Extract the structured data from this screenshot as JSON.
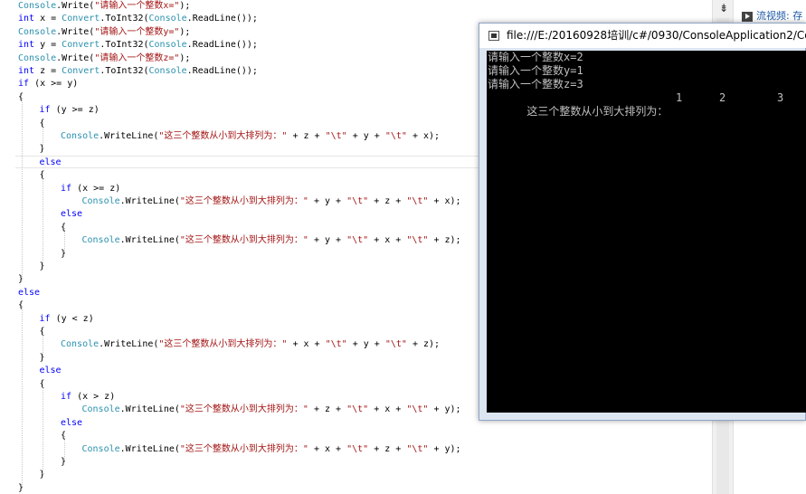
{
  "editor": {
    "lines": [
      {
        "indent": 0,
        "tokens": [
          {
            "t": "cls",
            "v": "Console"
          },
          {
            "t": "plain",
            "v": ".Write("
          },
          {
            "t": "str",
            "v": "\"请输入一个整数x=\""
          },
          {
            "t": "plain",
            "v": ");"
          }
        ]
      },
      {
        "indent": 0,
        "tokens": [
          {
            "t": "kw",
            "v": "int"
          },
          {
            "t": "plain",
            "v": " x = "
          },
          {
            "t": "cls",
            "v": "Convert"
          },
          {
            "t": "plain",
            "v": ".ToInt32("
          },
          {
            "t": "cls",
            "v": "Console"
          },
          {
            "t": "plain",
            "v": ".ReadLine());"
          }
        ]
      },
      {
        "indent": 0,
        "tokens": [
          {
            "t": "cls",
            "v": "Console"
          },
          {
            "t": "plain",
            "v": ".Write("
          },
          {
            "t": "str",
            "v": "\"请输入一个整数y=\""
          },
          {
            "t": "plain",
            "v": ");"
          }
        ]
      },
      {
        "indent": 0,
        "tokens": [
          {
            "t": "kw",
            "v": "int"
          },
          {
            "t": "plain",
            "v": " y = "
          },
          {
            "t": "cls",
            "v": "Convert"
          },
          {
            "t": "plain",
            "v": ".ToInt32("
          },
          {
            "t": "cls",
            "v": "Console"
          },
          {
            "t": "plain",
            "v": ".ReadLine());"
          }
        ]
      },
      {
        "indent": 0,
        "tokens": [
          {
            "t": "cls",
            "v": "Console"
          },
          {
            "t": "plain",
            "v": ".Write("
          },
          {
            "t": "str",
            "v": "\"请输入一个整数z=\""
          },
          {
            "t": "plain",
            "v": ");"
          }
        ]
      },
      {
        "indent": 0,
        "tokens": [
          {
            "t": "kw",
            "v": "int"
          },
          {
            "t": "plain",
            "v": " z = "
          },
          {
            "t": "cls",
            "v": "Convert"
          },
          {
            "t": "plain",
            "v": ".ToInt32("
          },
          {
            "t": "cls",
            "v": "Console"
          },
          {
            "t": "plain",
            "v": ".ReadLine());"
          }
        ]
      },
      {
        "indent": 0,
        "tokens": [
          {
            "t": "kw",
            "v": "if"
          },
          {
            "t": "plain",
            "v": " (x >= y)"
          }
        ]
      },
      {
        "indent": 0,
        "tokens": [
          {
            "t": "plain",
            "v": "{"
          }
        ]
      },
      {
        "indent": 1,
        "tokens": [
          {
            "t": "kw",
            "v": "if"
          },
          {
            "t": "plain",
            "v": " (y >= z)"
          }
        ]
      },
      {
        "indent": 1,
        "tokens": [
          {
            "t": "plain",
            "v": "{"
          }
        ]
      },
      {
        "indent": 2,
        "tokens": [
          {
            "t": "cls",
            "v": "Console"
          },
          {
            "t": "plain",
            "v": ".WriteLine("
          },
          {
            "t": "str",
            "v": "\"这三个整数从小到大排列为：\""
          },
          {
            "t": "plain",
            "v": " + z + "
          },
          {
            "t": "str",
            "v": "\"\\t\""
          },
          {
            "t": "plain",
            "v": " + y + "
          },
          {
            "t": "str",
            "v": "\"\\t\""
          },
          {
            "t": "plain",
            "v": " + x);"
          }
        ]
      },
      {
        "indent": 1,
        "tokens": [
          {
            "t": "plain",
            "v": "}"
          }
        ]
      },
      {
        "indent": 1,
        "tokens": [
          {
            "t": "kw",
            "v": "else"
          }
        ]
      },
      {
        "indent": 1,
        "tokens": [
          {
            "t": "plain",
            "v": "{"
          }
        ]
      },
      {
        "indent": 2,
        "tokens": [
          {
            "t": "kw",
            "v": "if"
          },
          {
            "t": "plain",
            "v": " (x >= z)"
          }
        ]
      },
      {
        "indent": 3,
        "tokens": [
          {
            "t": "cls",
            "v": "Console"
          },
          {
            "t": "plain",
            "v": ".WriteLine("
          },
          {
            "t": "str",
            "v": "\"这三个整数从小到大排列为：\""
          },
          {
            "t": "plain",
            "v": " + y + "
          },
          {
            "t": "str",
            "v": "\"\\t\""
          },
          {
            "t": "plain",
            "v": " + z + "
          },
          {
            "t": "str",
            "v": "\"\\t\""
          },
          {
            "t": "plain",
            "v": " + x);"
          }
        ]
      },
      {
        "indent": 2,
        "tokens": [
          {
            "t": "kw",
            "v": "else"
          }
        ]
      },
      {
        "indent": 2,
        "tokens": [
          {
            "t": "plain",
            "v": "{"
          }
        ]
      },
      {
        "indent": 3,
        "tokens": [
          {
            "t": "cls",
            "v": "Console"
          },
          {
            "t": "plain",
            "v": ".WriteLine("
          },
          {
            "t": "str",
            "v": "\"这三个整数从小到大排列为：\""
          },
          {
            "t": "plain",
            "v": " + y + "
          },
          {
            "t": "str",
            "v": "\"\\t\""
          },
          {
            "t": "plain",
            "v": " + x + "
          },
          {
            "t": "str",
            "v": "\"\\t\""
          },
          {
            "t": "plain",
            "v": " + z);"
          }
        ]
      },
      {
        "indent": 2,
        "tokens": [
          {
            "t": "plain",
            "v": "}"
          }
        ]
      },
      {
        "indent": 1,
        "tokens": [
          {
            "t": "plain",
            "v": "}"
          }
        ]
      },
      {
        "indent": 0,
        "tokens": [
          {
            "t": "plain",
            "v": "}"
          }
        ]
      },
      {
        "indent": 0,
        "tokens": [
          {
            "t": "kw",
            "v": "else"
          }
        ]
      },
      {
        "indent": 0,
        "tokens": [
          {
            "t": "plain",
            "v": "{"
          }
        ]
      },
      {
        "indent": 1,
        "tokens": [
          {
            "t": "kw",
            "v": "if"
          },
          {
            "t": "plain",
            "v": " (y < z)"
          }
        ]
      },
      {
        "indent": 1,
        "tokens": [
          {
            "t": "plain",
            "v": "{"
          }
        ]
      },
      {
        "indent": 2,
        "tokens": [
          {
            "t": "cls",
            "v": "Console"
          },
          {
            "t": "plain",
            "v": ".WriteLine("
          },
          {
            "t": "str",
            "v": "\"这三个整数从小到大排列为：\""
          },
          {
            "t": "plain",
            "v": " + x + "
          },
          {
            "t": "str",
            "v": "\"\\t\""
          },
          {
            "t": "plain",
            "v": " + y + "
          },
          {
            "t": "str",
            "v": "\"\\t\""
          },
          {
            "t": "plain",
            "v": " + z);"
          }
        ]
      },
      {
        "indent": 1,
        "tokens": [
          {
            "t": "plain",
            "v": "}"
          }
        ]
      },
      {
        "indent": 1,
        "tokens": [
          {
            "t": "kw",
            "v": "else"
          }
        ]
      },
      {
        "indent": 1,
        "tokens": [
          {
            "t": "plain",
            "v": "{"
          }
        ]
      },
      {
        "indent": 2,
        "tokens": [
          {
            "t": "kw",
            "v": "if"
          },
          {
            "t": "plain",
            "v": " (x > z)"
          }
        ]
      },
      {
        "indent": 3,
        "tokens": [
          {
            "t": "cls",
            "v": "Console"
          },
          {
            "t": "plain",
            "v": ".WriteLine("
          },
          {
            "t": "str",
            "v": "\"这三个整数从小到大排列为：\""
          },
          {
            "t": "plain",
            "v": " + z + "
          },
          {
            "t": "str",
            "v": "\"\\t\""
          },
          {
            "t": "plain",
            "v": " + x + "
          },
          {
            "t": "str",
            "v": "\"\\t\""
          },
          {
            "t": "plain",
            "v": " + y);"
          }
        ]
      },
      {
        "indent": 2,
        "tokens": [
          {
            "t": "kw",
            "v": "else"
          }
        ]
      },
      {
        "indent": 2,
        "tokens": [
          {
            "t": "plain",
            "v": "{"
          }
        ]
      },
      {
        "indent": 3,
        "tokens": [
          {
            "t": "cls",
            "v": "Console"
          },
          {
            "t": "plain",
            "v": ".WriteLine("
          },
          {
            "t": "str",
            "v": "\"这三个整数从小到大排列为：\""
          },
          {
            "t": "plain",
            "v": " + x + "
          },
          {
            "t": "str",
            "v": "\"\\t\""
          },
          {
            "t": "plain",
            "v": " + z + "
          },
          {
            "t": "str",
            "v": "\"\\t\""
          },
          {
            "t": "plain",
            "v": " + y);"
          }
        ]
      },
      {
        "indent": 2,
        "tokens": [
          {
            "t": "plain",
            "v": "}"
          }
        ]
      },
      {
        "indent": 1,
        "tokens": [
          {
            "t": "plain",
            "v": "}"
          }
        ]
      },
      {
        "indent": 0,
        "tokens": [
          {
            "t": "plain",
            "v": "}"
          }
        ]
      }
    ]
  },
  "console": {
    "title": "file:///E:/20160928培训/c#/0930/ConsoleApplication2/Co",
    "output": [
      "请输入一个整数x=2",
      "请输入一个整数y=1",
      "请输入一个整数z=3"
    ],
    "result": {
      "label": "这三个整数从小到大排列为：",
      "values": [
        "1",
        "2",
        "3"
      ]
    }
  },
  "side_panel": {
    "link_label": "流视频: 存",
    "link_icon": "play-icon",
    "split_icon": "split-icon"
  },
  "colors": {
    "keyword": "#0000ff",
    "class": "#2b91af",
    "string": "#a31515",
    "console_bg": "#000000",
    "console_text": "#c0c0c0",
    "link": "#1e5aa8"
  }
}
